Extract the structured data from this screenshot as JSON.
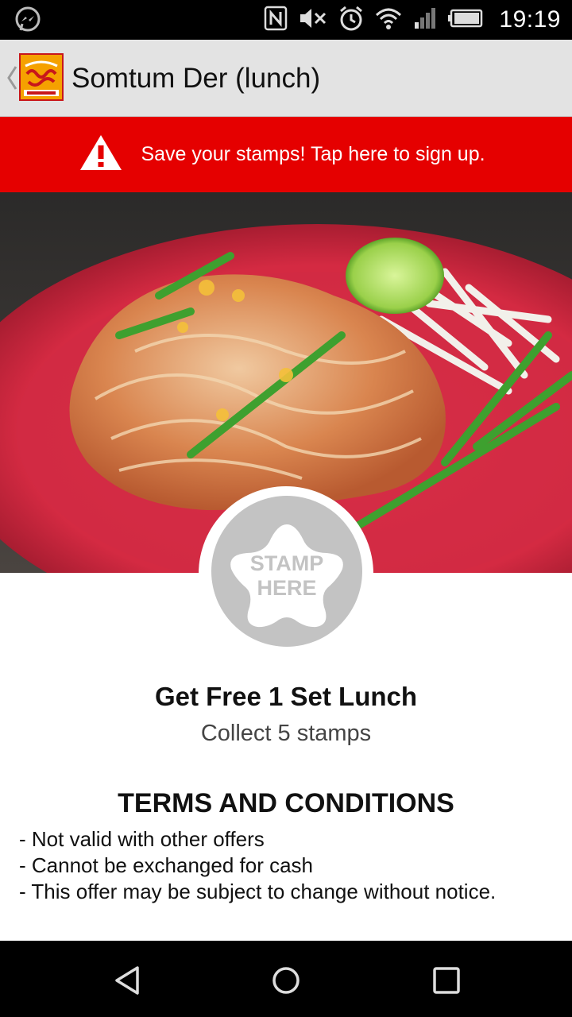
{
  "status_bar": {
    "time": "19:19",
    "icons": [
      "messenger-icon",
      "nfc-icon",
      "mute-icon",
      "alarm-icon",
      "wifi-icon",
      "signal-icon",
      "battery-icon"
    ]
  },
  "header": {
    "title": "Somtum Der (lunch)",
    "logo_name": "somtum-der-logo"
  },
  "banner": {
    "text": "Save your stamps! Tap here to sign up.",
    "background": "#e50000"
  },
  "stamp": {
    "line1": "STAMP",
    "line2": "HERE"
  },
  "reward": {
    "title": "Get Free 1 Set Lunch",
    "subtitle": "Collect 5 stamps"
  },
  "terms": {
    "title": "TERMS AND CONDITIONS",
    "items": [
      "- Not valid with other offers",
      "- Cannot be exchanged for cash",
      "- This offer may be subject to change without notice."
    ]
  },
  "nav": [
    "back-icon",
    "home-icon",
    "recents-icon"
  ]
}
